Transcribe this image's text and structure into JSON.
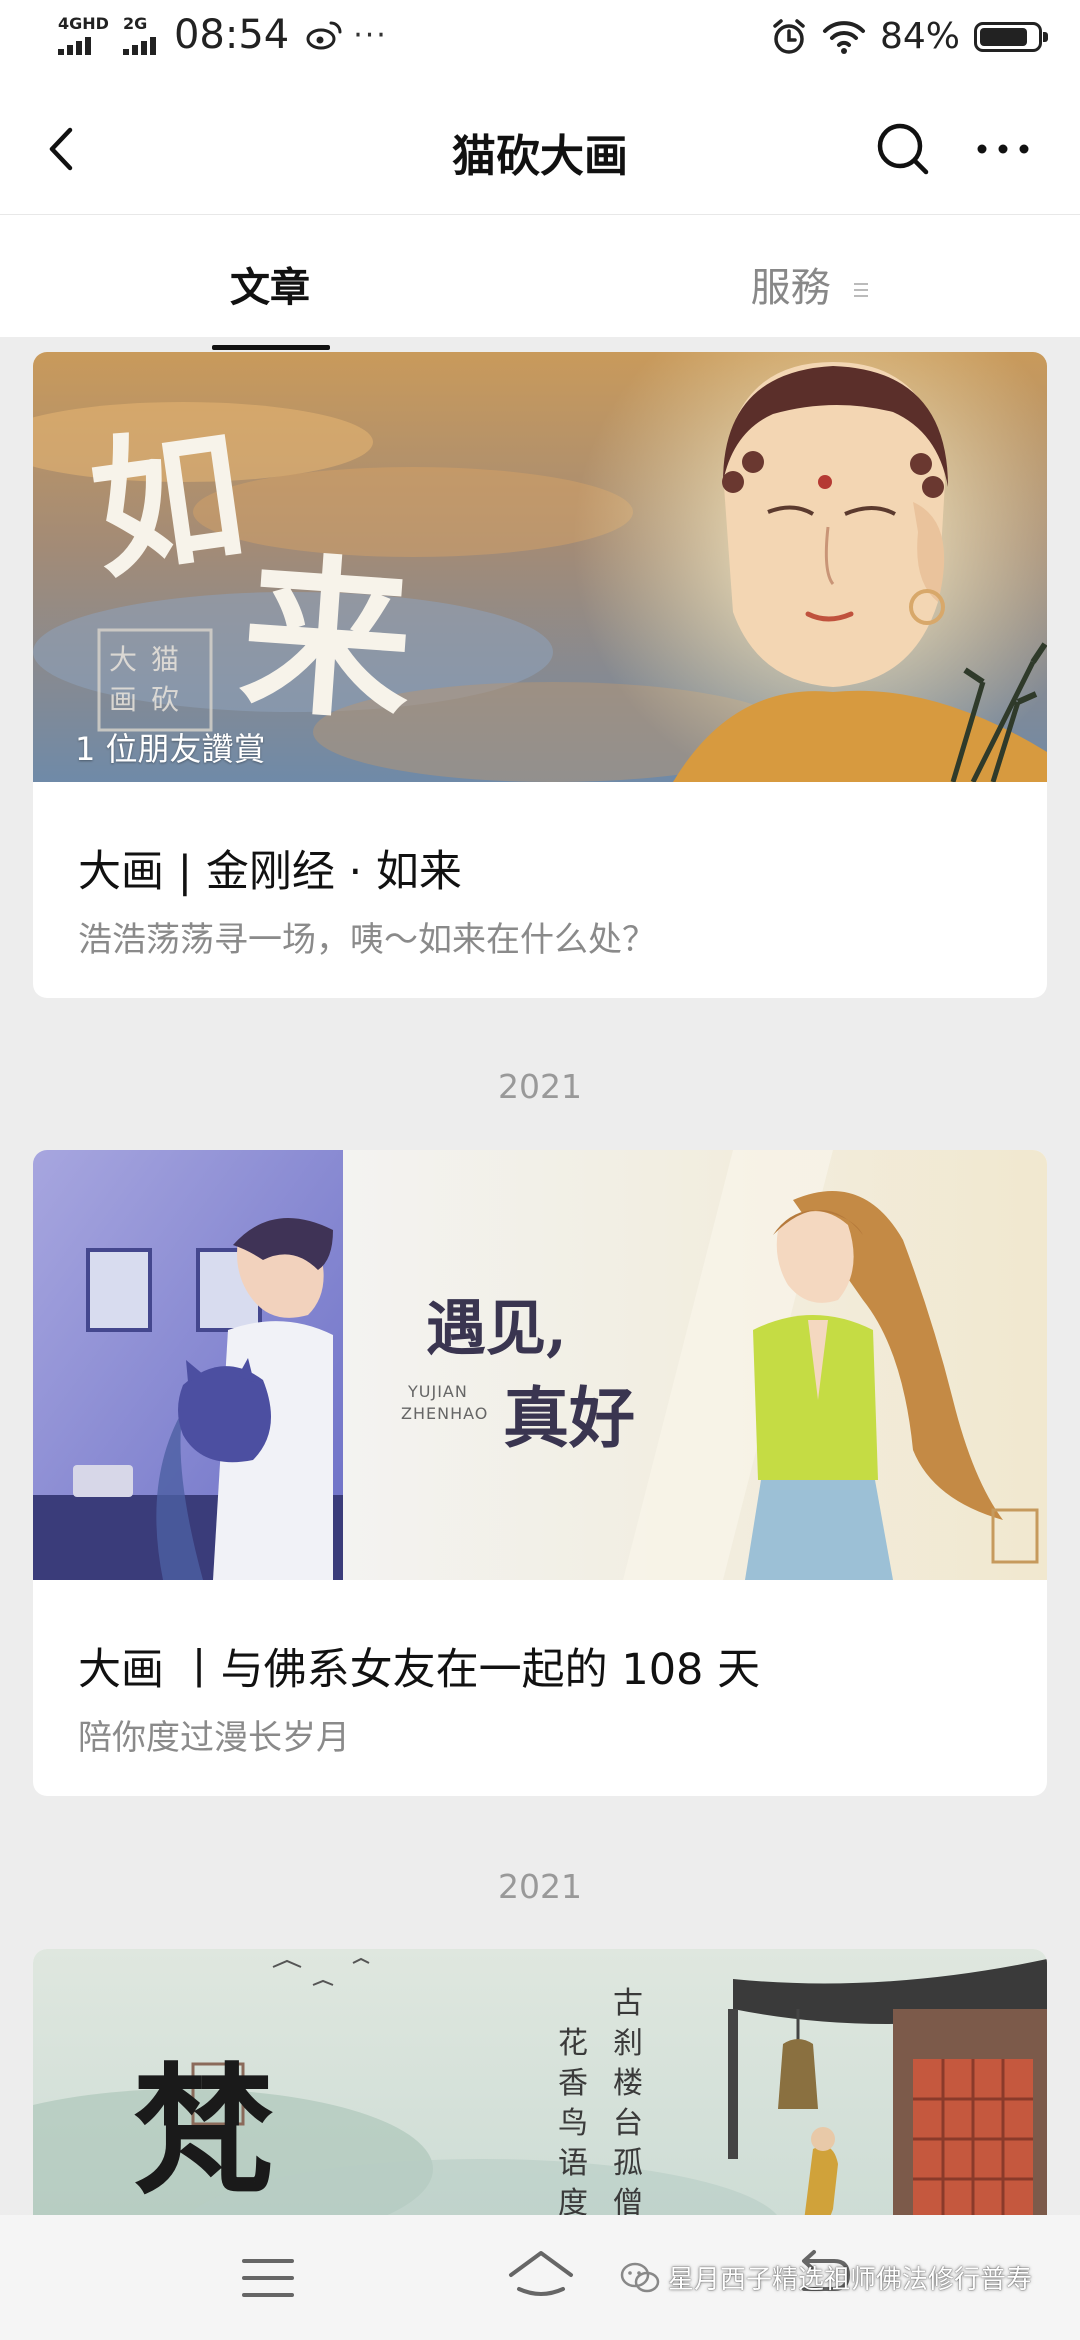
{
  "status_bar": {
    "network1": "4GHD",
    "network2": "2G",
    "time": "08:54",
    "more": "···",
    "battery_text": "84%",
    "battery_level": 0.84
  },
  "header": {
    "title": "猫砍大画"
  },
  "tabs": [
    {
      "label": "文章",
      "active": true
    },
    {
      "label": "服務",
      "active": false
    }
  ],
  "articles": [
    {
      "image_text_1": "如",
      "image_text_2": "来",
      "image_seal": "大猫 画砍",
      "appreciation": "1 位朋友讚賞",
      "title": "大画 | 金刚经 · 如来",
      "subtitle": "浩浩荡荡寻一场，咦～如来在什么处？"
    },
    {
      "image_text_1": "遇见,",
      "image_text_2": "真好",
      "image_romanized_1": "YUJIAN",
      "image_romanized_2": "ZHENHAO",
      "title": "大画 丨与佛系女友在一起的 108 天",
      "subtitle": "陪你度过漫长岁月"
    },
    {
      "image_text_1": "梵",
      "image_poem_1": "古刹楼台孤僧处",
      "image_poem_2": "花香鸟语度梵"
    }
  ],
  "year_labels": [
    "2021",
    "2021"
  ],
  "bottom_nav": {
    "watermark": "星月西子精选祖师佛法修行普寿"
  },
  "colors": {
    "background": "#ededed",
    "card": "#ffffff",
    "title": "#111111",
    "subtitle": "#8a8a8a",
    "year": "#999999"
  }
}
